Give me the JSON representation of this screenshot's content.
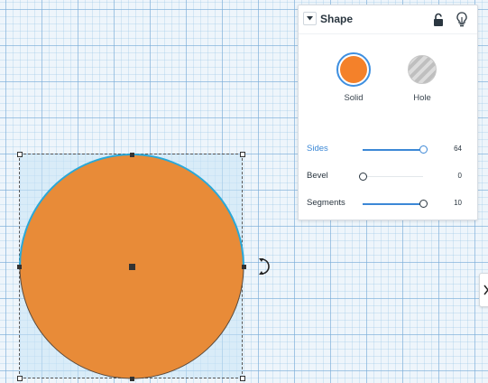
{
  "inspector": {
    "title": "Shape",
    "shape_types": [
      {
        "label": "Solid",
        "selected": true
      },
      {
        "label": "Hole",
        "selected": false
      }
    ],
    "params": [
      {
        "label": "Sides",
        "value": "64",
        "level": 1.0,
        "active": true
      },
      {
        "label": "Bevel",
        "value": "0",
        "level": 0.0,
        "active": false
      },
      {
        "label": "Segments",
        "value": "10",
        "level": 1.0,
        "active": false
      }
    ]
  },
  "colors": {
    "shape_fill": "#e88b38",
    "solid_swatch": "#f4812a",
    "accent": "#3c88d6",
    "selection_outline": "#2aa8d8"
  },
  "icons": {
    "collapse": "caret-down-icon",
    "lock": "unlock-icon",
    "light": "lightbulb-icon",
    "rotate": "rotate-icon",
    "panel_toggle": "chevron-right-icon"
  }
}
